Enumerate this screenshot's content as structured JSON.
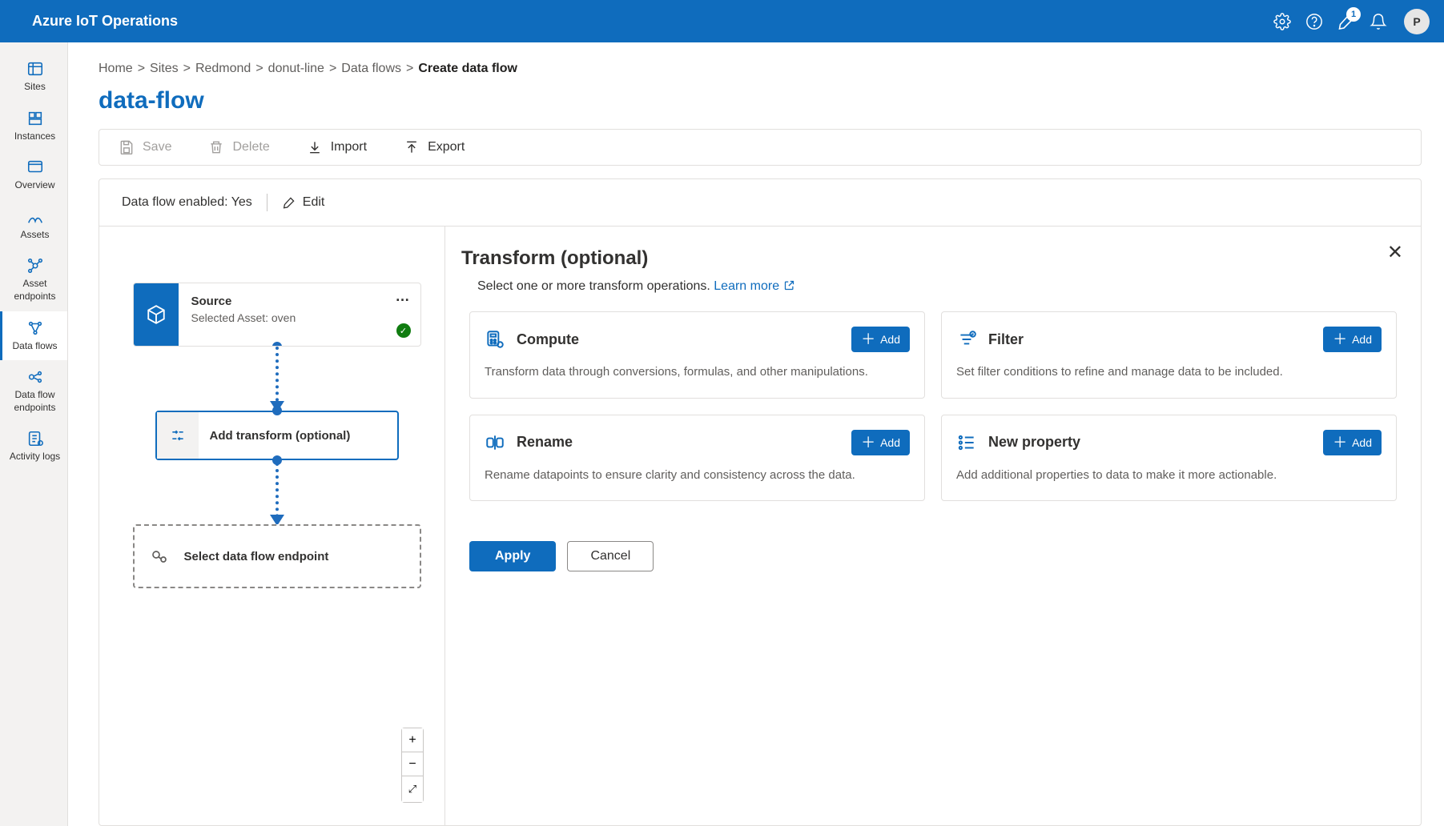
{
  "header": {
    "brand": "Azure IoT Operations",
    "notificationCount": "1",
    "avatarInitial": "P"
  },
  "sidebar": {
    "items": [
      {
        "label": "Sites"
      },
      {
        "label": "Instances"
      },
      {
        "label": "Overview"
      },
      {
        "label": "Assets"
      },
      {
        "label": "Asset endpoints"
      },
      {
        "label": "Data flows"
      },
      {
        "label": "Data flow endpoints"
      },
      {
        "label": "Activity logs"
      }
    ]
  },
  "breadcrumbs": {
    "items": [
      "Home",
      "Sites",
      "Redmond",
      "donut-line",
      "Data flows"
    ],
    "current": "Create data flow",
    "sep": ">"
  },
  "page": {
    "title": "data-flow"
  },
  "toolbar": {
    "save": "Save",
    "delete": "Delete",
    "import": "Import",
    "export": "Export"
  },
  "workspaceHeader": {
    "enabledLabel": "Data flow enabled: Yes",
    "editLabel": "Edit"
  },
  "canvas": {
    "source": {
      "title": "Source",
      "subtitle": "Selected Asset: oven"
    },
    "transform": {
      "label": "Add transform (optional)"
    },
    "endpoint": {
      "label": "Select data flow endpoint"
    },
    "controls": {
      "zoomIn": "+",
      "zoomOut": "−",
      "fit": "⤢"
    }
  },
  "panel": {
    "title": "Transform (optional)",
    "subtitle": "Select one or more transform operations.",
    "learnMore": "Learn more",
    "addLabel": "Add",
    "cards": [
      {
        "title": "Compute",
        "desc": "Transform data through conversions, formulas, and other manipulations."
      },
      {
        "title": "Filter",
        "desc": "Set filter conditions to refine and manage data to be included."
      },
      {
        "title": "Rename",
        "desc": "Rename datapoints to ensure clarity and consistency across the data."
      },
      {
        "title": "New property",
        "desc": "Add additional properties to data to make it more actionable."
      }
    ],
    "applyLabel": "Apply",
    "cancelLabel": "Cancel"
  }
}
